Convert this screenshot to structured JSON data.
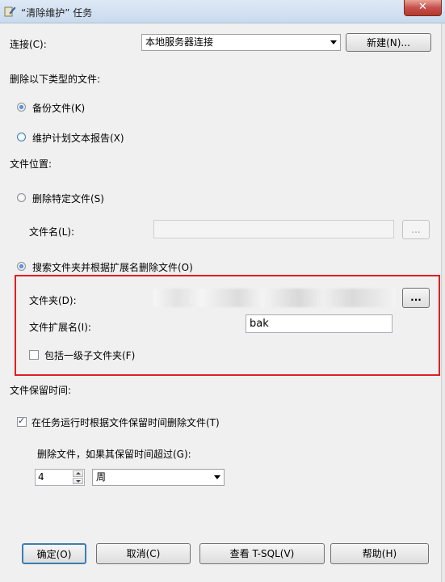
{
  "window": {
    "title": "“清除维护” 任务",
    "close_label": "✕"
  },
  "connection": {
    "label": "连接(C):",
    "value": "本地服务器连接",
    "new_button": "新建(N)..."
  },
  "delete_type": {
    "heading": "删除以下类型的文件:",
    "option_backup": "备份文件(K)",
    "option_report": "维护计划文本报告(X)"
  },
  "file_location": {
    "heading": "文件位置:",
    "option_specific": "删除特定文件(S)",
    "filename_label": "文件名(L):",
    "filename_value": "",
    "browse_disabled": "...",
    "option_search": "搜索文件夹并根据扩展名删除文件(O)",
    "folder_label": "文件夹(D):",
    "browse": "...",
    "extension_label": "文件扩展名(I):",
    "extension_value": "bak",
    "include_subfolders": "包括一级子文件夹(F)"
  },
  "retention": {
    "heading": "文件保留时间:",
    "delete_by_age": "在任务运行时根据文件保留时间删除文件(T)",
    "older_than_label": "删除文件，如果其保留时间超过(G):",
    "amount": "4",
    "unit": "周"
  },
  "buttons": {
    "ok": "确定(O)",
    "cancel": "取消(C)",
    "view_tsql": "查看 T-SQL(V)",
    "help": "帮助(H)"
  }
}
